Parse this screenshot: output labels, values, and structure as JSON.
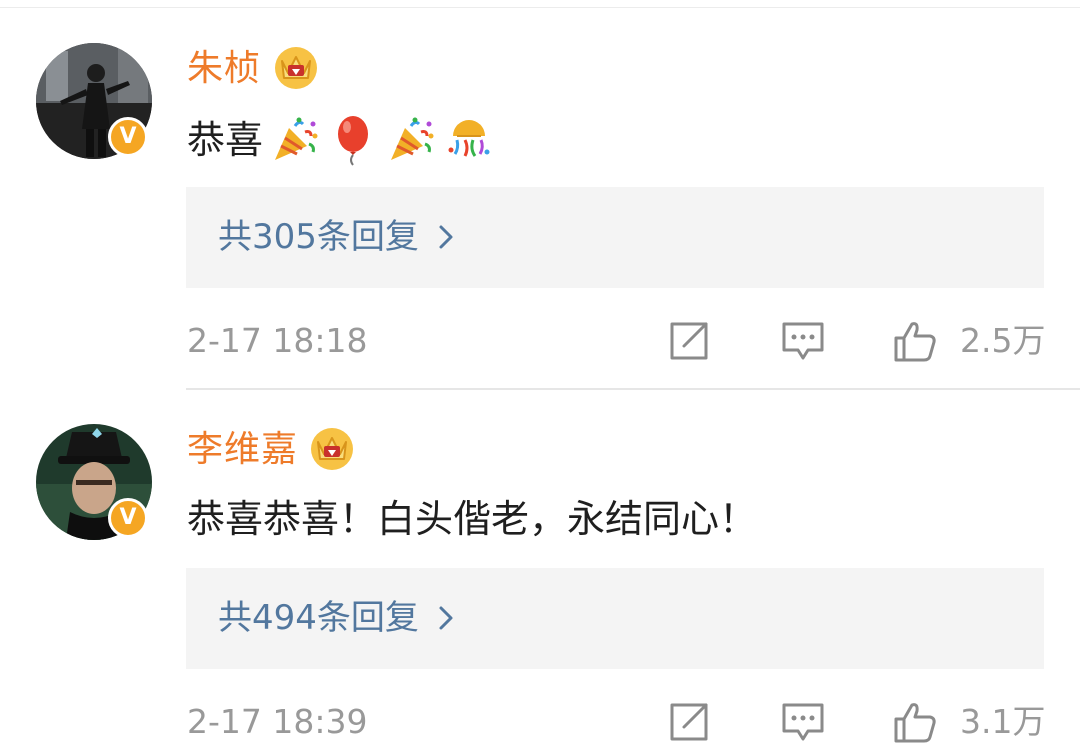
{
  "comments": [
    {
      "username": "朱桢",
      "avatar_icon": "avatar-photo",
      "badge_label": "V",
      "badge_color": "#f5a623",
      "crown_icon": "crown-icon",
      "text": "恭喜",
      "emojis": [
        "party-popper-icon",
        "balloon-icon",
        "party-popper-icon",
        "confetti-ball-icon"
      ],
      "replies_label": "共305条回复",
      "timestamp": "2-17 18:18",
      "like_count": "2.5万"
    },
    {
      "username": "李维嘉",
      "avatar_icon": "avatar-photo",
      "badge_label": "V",
      "badge_color": "#f5a623",
      "crown_icon": "crown-icon",
      "text": "恭喜恭喜！白头偕老，永结同心！",
      "emojis": [],
      "replies_label": "共494条回复",
      "timestamp": "2-17 18:39",
      "like_count": "3.1万"
    }
  ],
  "colors": {
    "username": "#ee7b2a",
    "link": "#52779e",
    "meta": "#999999",
    "replies_bg": "#f4f4f4"
  }
}
